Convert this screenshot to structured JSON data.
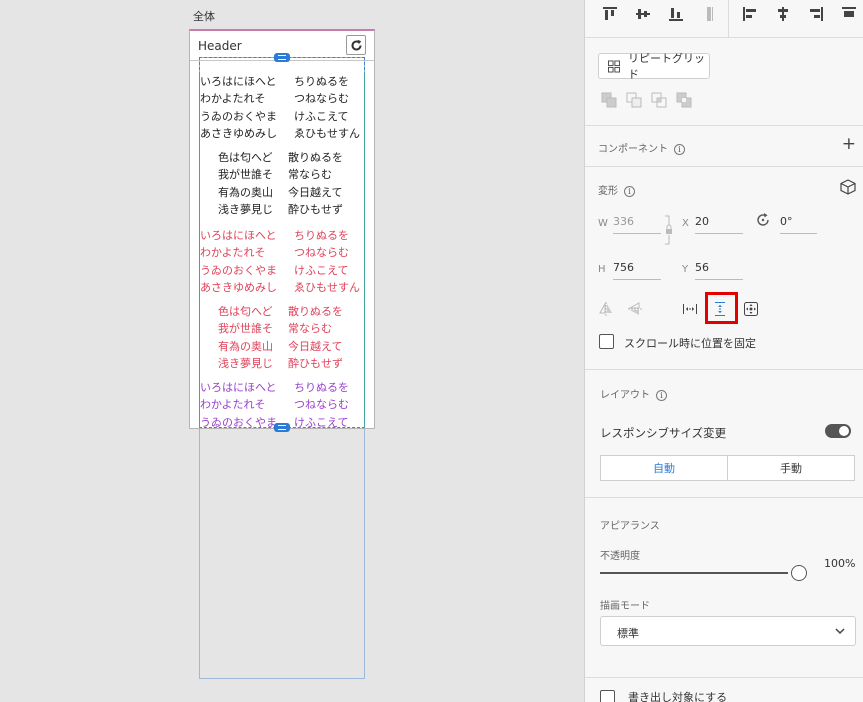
{
  "canvas": {
    "artboard_label": "全体",
    "header_title": "Header",
    "text_blocks": [
      {
        "color": "black",
        "indented": false,
        "lines": [
          [
            "いろはにほへと",
            "ちりぬるを"
          ],
          [
            "わかよたれそ",
            "つねならむ"
          ],
          [
            "うゐのおくやま",
            "けふこえて"
          ],
          [
            "あさきゆめみし",
            "ゑひもせすん"
          ]
        ]
      },
      {
        "color": "black",
        "indented": true,
        "lines": [
          [
            "色は匂へど",
            "散りぬるを"
          ],
          [
            "我が世誰そ",
            "常ならむ"
          ],
          [
            "有為の奥山",
            "今日越えて"
          ],
          [
            "浅き夢見じ",
            "酔ひもせず"
          ]
        ]
      },
      {
        "color": "red",
        "indented": false,
        "lines": [
          [
            "いろはにほへと",
            "ちりぬるを"
          ],
          [
            "わかよたれそ",
            "つねならむ"
          ],
          [
            "うゐのおくやま",
            "けふこえて"
          ],
          [
            "あさきゆめみし",
            "ゑひもせすん"
          ]
        ]
      },
      {
        "color": "red",
        "indented": true,
        "lines": [
          [
            "色は匂へど",
            "散りぬるを"
          ],
          [
            "我が世誰そ",
            "常ならむ"
          ],
          [
            "有為の奥山",
            "今日越えて"
          ],
          [
            "浅き夢見じ",
            "酔ひもせず"
          ]
        ]
      },
      {
        "color": "purple",
        "indented": false,
        "lines": [
          [
            "いろはにほへと",
            "ちりぬるを"
          ],
          [
            "わかよたれそ",
            "つねならむ"
          ],
          [
            "うゐのおくやま",
            "けふこえて"
          ]
        ]
      }
    ],
    "colors": {
      "black": "#222222",
      "red": "#e0425a",
      "purple": "#9a3fd0",
      "selection": "#2b7bd6"
    }
  },
  "panel": {
    "repeat_grid_label": "リピートグリッド",
    "component_title": "コンポーネント",
    "transform_title": "変形",
    "w_label": "W",
    "w_value": "336",
    "x_label": "X",
    "x_value": "20",
    "rotation_value": "0°",
    "h_label": "H",
    "h_value": "756",
    "y_label": "Y",
    "y_value": "56",
    "fix_scroll_label": "スクロール時に位置を固定",
    "layout_title": "レイアウト",
    "responsive_label": "レスポンシブサイズ変更",
    "responsive_on": true,
    "seg_auto": "自動",
    "seg_manual": "手動",
    "appearance_title": "アピアランス",
    "opacity_label": "不透明度",
    "opacity_value": "100%",
    "opacity_level": 1.0,
    "blend_label": "描画モード",
    "blend_value": "標準",
    "export_label": "書き出し対象にする"
  }
}
